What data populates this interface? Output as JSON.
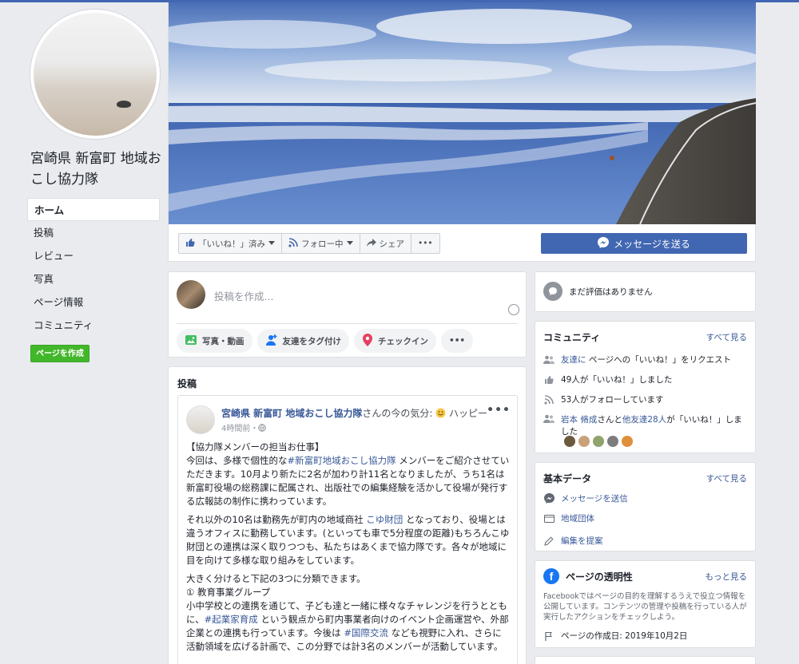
{
  "page": {
    "name": "宮崎県 新富町 地域おこし協力隊"
  },
  "nav": {
    "items": [
      {
        "label": "ホーム"
      },
      {
        "label": "投稿"
      },
      {
        "label": "レビュー"
      },
      {
        "label": "写真"
      },
      {
        "label": "ページ情報"
      },
      {
        "label": "コミュニティ"
      }
    ],
    "create_page": "ページを作成"
  },
  "actions": {
    "liked": "「いいね！」済み",
    "following": "フォロー中",
    "share": "シェア",
    "more": "•••",
    "message": "メッセージを送る"
  },
  "composer": {
    "placeholder": "投稿を作成...",
    "photo": "写真・動画",
    "tag": "友達をタグ付け",
    "checkin": "チェックイン",
    "more": "•••"
  },
  "posts": {
    "title": "投稿",
    "post": {
      "author": "宮崎県 新富町 地域おこし協力隊",
      "feeling_prefix": "さんの今の気分: ",
      "feeling": "ハッピー",
      "time": "4時間前・",
      "more": "•••",
      "p1_l1": "【協力隊メンバーの担当お仕事】",
      "p1_l2a": "今回は、多様で個性的な",
      "p1_tag": "#新富町地域おこし協力隊",
      "p1_l2b": "メンバーをご紹介させていただきます。10月より新たに2名が加わり計11名となりましたが、うち1名は新富町役場の総務課に配属され、出版社での編集経験を活かして役場が発行する広報誌の制作に携わっています。",
      "p2a": "それ以外の10名は勤務先が町内の地域商社",
      "p2_link": "こゆ財団",
      "p2b": "となっており、役場とは違うオフィスに勤務しています。(といっても車で5分程度の距離)もちろんこゆ財団との連携は深く取りつつも、私たちはあくまで協力隊です。各々が地域に目を向けて多様な取り組みをしています。",
      "p3_l1": "大きく分けると下記の3つに分類できます。",
      "p3_l2": "① 教育事業グループ",
      "p3_l3a": "小中学校との連携を通じて、子ども達と一緒に様々なチャレンジを行うとともに、",
      "p3_tag1": "#起業家育成",
      "p3_l3b": "という観点から町内事業者向けのイベント企画運営や、外部企業との連携も行っています。今後は",
      "p3_tag2": "#国際交流",
      "p3_l3c": "なども視野に入れ、さらに活動領域を広げる計画で、この分野では計3名のメンバーが活動しています。"
    }
  },
  "reviews": {
    "text": "まだ評価はありません"
  },
  "community": {
    "title": "コミュニティ",
    "see_all": "すべて見る",
    "invite_link": "友達に",
    "invite_text": "ページへの「いいね！」をリクエスト",
    "likes": "49人が「いいね！」しました",
    "follows": "53人がフォローしています",
    "friend_name": "岩本 脩成",
    "friend_mid": "さんと",
    "friend_others": "他友達28人",
    "friend_tail": "が「いいね！」しました"
  },
  "basic": {
    "title": "基本データ",
    "see_all": "すべて見る",
    "send_message": "メッセージを送信",
    "category": "地域団体",
    "suggest_edit": "編集を提案"
  },
  "transparency": {
    "title": "ページの透明性",
    "see_more": "もっと見る",
    "description": "Facebookではページの目的を理解するうえで役立つ情報を公開しています。コンテンツの管理や投稿を行っている人が実行したアクションをチェックしよう。",
    "created": "ページの作成日: 2019年10月2日"
  },
  "colors": {
    "brand": "#4267b2",
    "link": "#385898",
    "create_green": "#42b72a"
  }
}
